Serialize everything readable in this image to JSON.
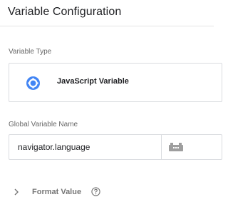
{
  "header": {
    "title": "Variable Configuration"
  },
  "variable_type": {
    "label": "Variable Type",
    "selected": "JavaScript Variable",
    "icon": "javascript-variable-icon",
    "icon_color": "#4285f4"
  },
  "global_variable_name": {
    "label": "Global Variable Name",
    "value": "navigator.language",
    "picker_icon": "variable-picker-icon"
  },
  "format_value": {
    "label": "Format Value",
    "expand_icon": "chevron-right-icon",
    "help_icon": "help-icon"
  }
}
